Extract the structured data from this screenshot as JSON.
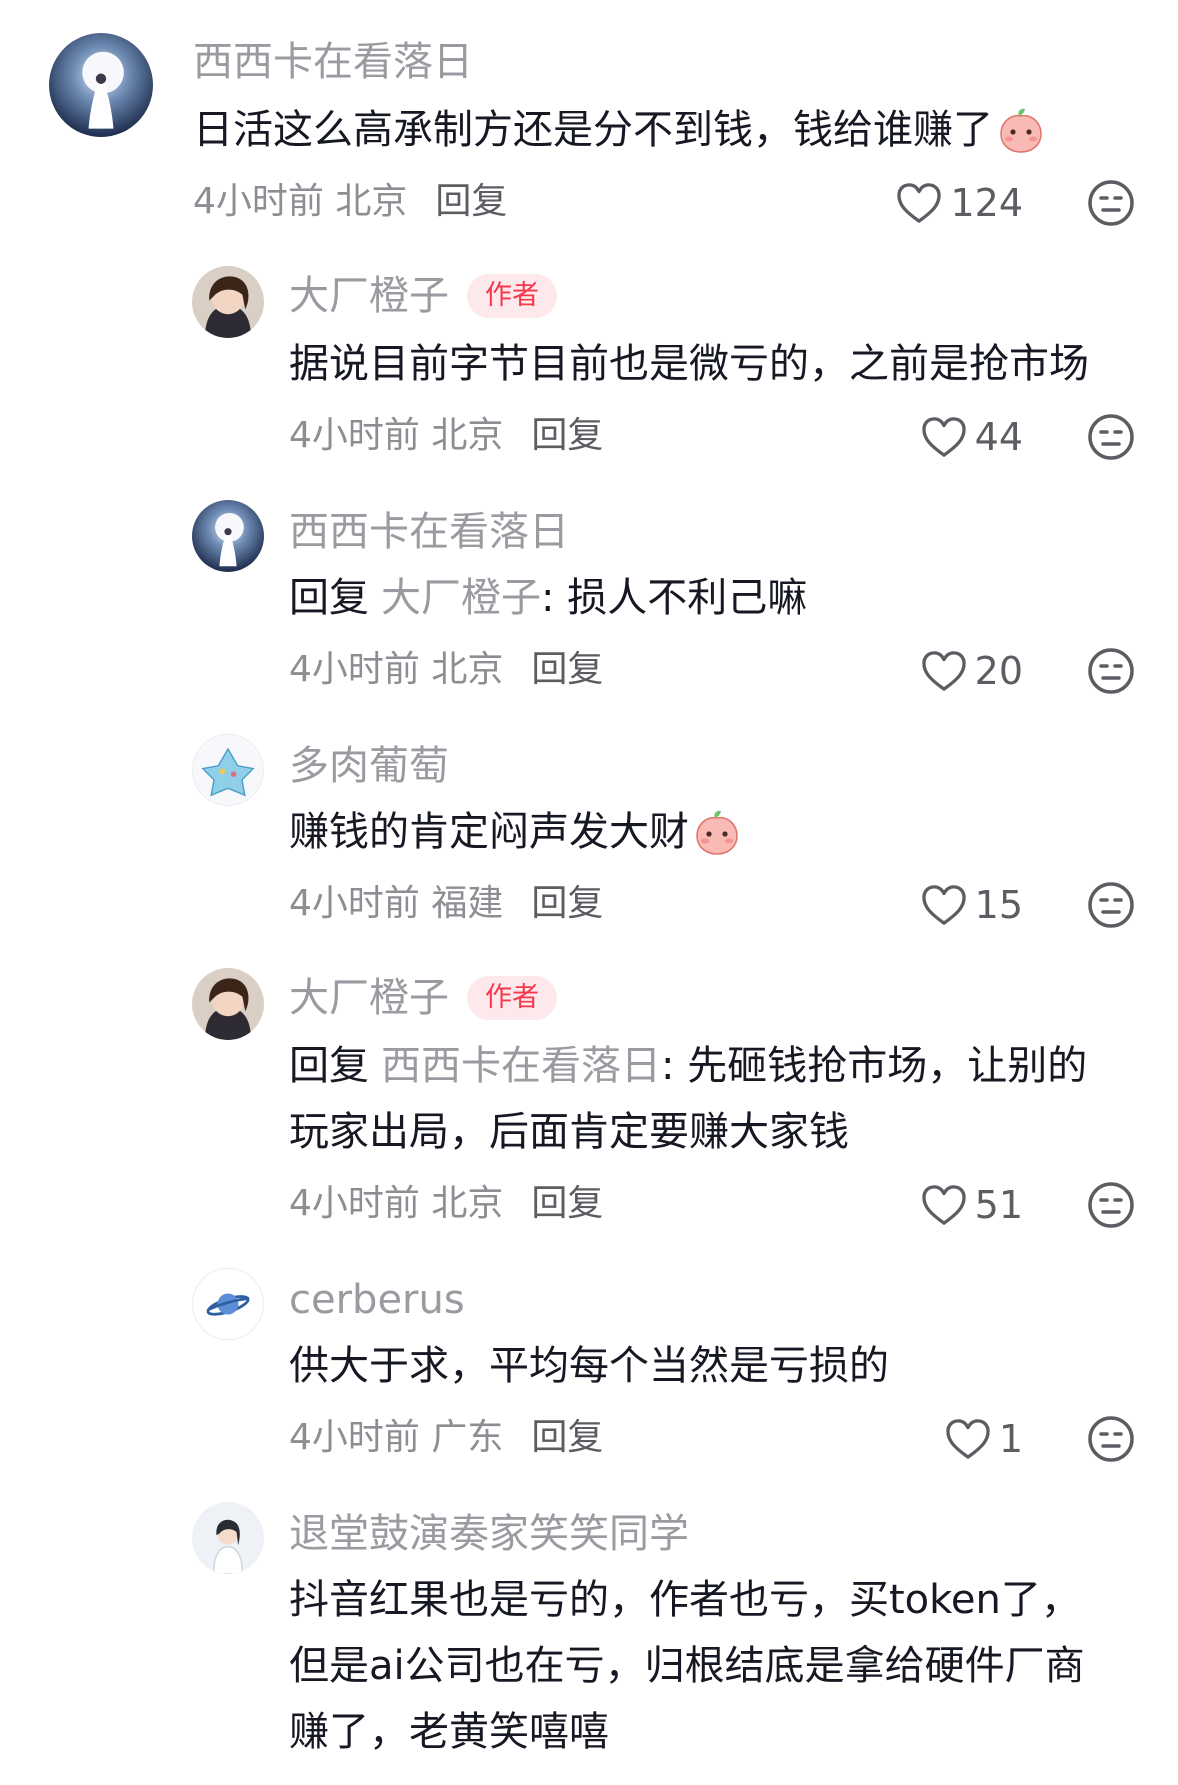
{
  "comments": [
    {
      "username": "西西卡在看落日",
      "text": "日活这么高承制方还是分不到钱，钱给谁赚了",
      "emoji": "shush-peach-emoji",
      "time": "4小时前",
      "location": "北京",
      "reply_label": "回复",
      "likes": "124"
    }
  ],
  "replies": [
    {
      "username": "大厂橙子",
      "badge": "作者",
      "text": "据说目前字节目前也是微亏的，之前是抢市场",
      "time": "4小时前",
      "location": "北京",
      "reply_label": "回复",
      "likes": "44"
    },
    {
      "username": "西西卡在看落日",
      "reply_prefix": "回复",
      "reply_to": "大厂橙子",
      "text": ": 损人不利己嘛",
      "time": "4小时前",
      "location": "北京",
      "reply_label": "回复",
      "likes": "20"
    },
    {
      "username": "多肉葡萄",
      "text": "赚钱的肯定闷声发大财",
      "emoji": "crying-peach-emoji",
      "time": "4小时前",
      "location": "福建",
      "reply_label": "回复",
      "likes": "15"
    },
    {
      "username": "大厂橙子",
      "badge": "作者",
      "reply_prefix": "回复",
      "reply_to": "西西卡在看落日",
      "text_line1": ": 先砸钱抢市场，让别的",
      "text_line2": "玩家出局，后面肯定要赚大家钱",
      "time": "4小时前",
      "location": "北京",
      "reply_label": "回复",
      "likes": "51"
    },
    {
      "username": "cerberus",
      "text": "供大于求，平均每个当然是亏损的",
      "time": "4小时前",
      "location": "广东",
      "reply_label": "回复",
      "likes": "1"
    },
    {
      "username": "退堂鼓演奏家笑笑同学",
      "text_line1": "抖音红果也是亏的，作者也亏，买token了，",
      "text_line2": "但是ai公司也在亏，归根结底是拿给硬件厂商",
      "text_line3": "赚了，老黄笑嘻嘻"
    }
  ],
  "colors": {
    "username": "#9a9ba0",
    "text": "#161823",
    "meta": "#8d8e93",
    "badge_bg": "#fde9ec",
    "badge_text": "#f5374d"
  },
  "icons": [
    "heart-icon",
    "dislike-face-icon",
    "peach-emoji"
  ]
}
